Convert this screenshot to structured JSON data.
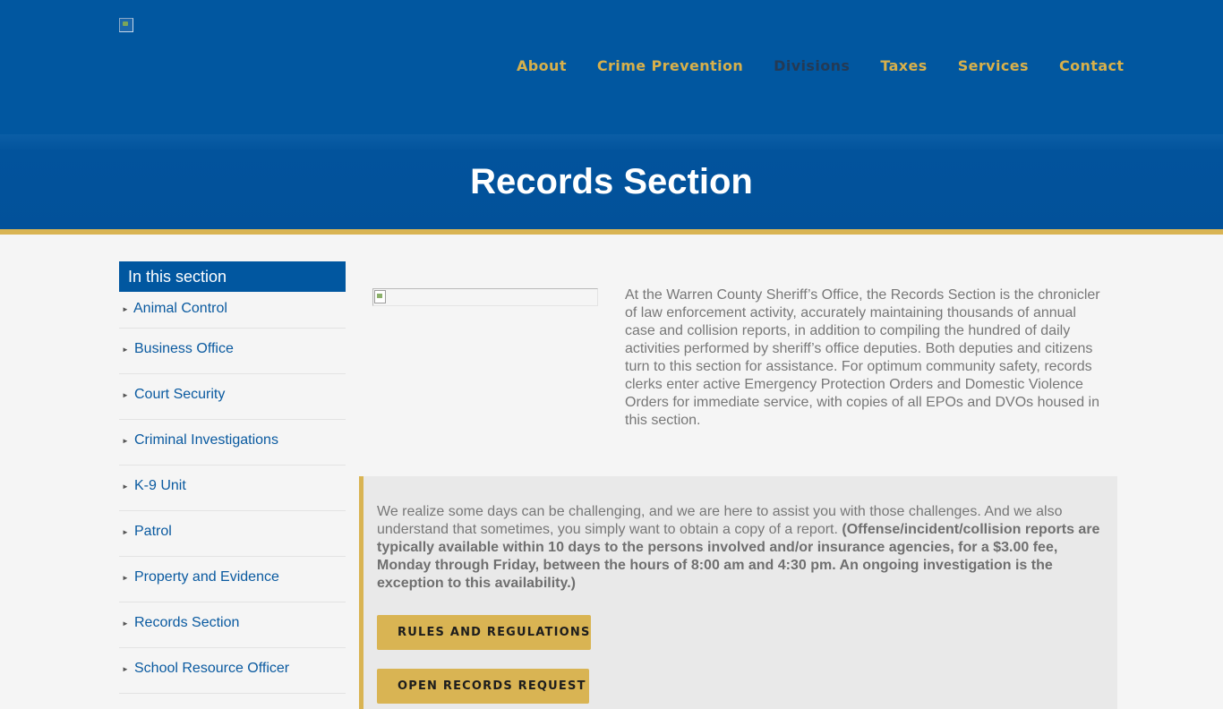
{
  "header": {
    "logo_icon": "broken-image-icon",
    "nav": [
      {
        "label": "About",
        "active": false
      },
      {
        "label": "Crime Prevention",
        "active": false
      },
      {
        "label": "Divisions",
        "active": true
      },
      {
        "label": "Taxes",
        "active": false
      },
      {
        "label": "Services",
        "active": false
      },
      {
        "label": "Contact",
        "active": false
      }
    ]
  },
  "hero": {
    "title": "Records Section"
  },
  "sidebar": {
    "heading": "In this section",
    "items": [
      {
        "label": "Animal Control"
      },
      {
        "label": "Business Office"
      },
      {
        "label": "Court Security"
      },
      {
        "label": "Criminal Investigations"
      },
      {
        "label": "K-9 Unit"
      },
      {
        "label": "Patrol"
      },
      {
        "label": "Property and Evidence"
      },
      {
        "label": "Records Section"
      },
      {
        "label": "School Resource Officer"
      }
    ],
    "arrow_glyph": "►"
  },
  "main": {
    "image_icon": "broken-image-icon",
    "intro": "At the Warren County Sheriff’s Office, the Records Section is the chronicler of law enforcement activity, accurately maintaining thousands of annual case and collision reports, in addition to compiling the hundred of daily activities performed by sheriff’s office deputies. Both deputies and citizens turn to this section for assistance. For optimum community safety, records clerks enter active Emergency Protection Orders and Domestic Violence Orders for immediate service, with copies of all EPOs and DVOs housed in this section.",
    "notice": {
      "text": "We realize some days can be challenging, and we are here to assist you with those challenges. And we also understand that sometimes, you simply want to obtain a copy of a report.",
      "bold": "(Offense/incident/collision reports are typically available within 10 days to the persons involved and/or insurance agencies, for a $3.00 fee, Monday through Friday, between the hours of 8:00 am and 4:30 pm. An ongoing investigation is the exception to this availability.)",
      "buttons": {
        "rules": "RULES AND REGULATIONS",
        "open_records": "OPEN RECORDS REQUEST"
      }
    }
  },
  "colors": {
    "primary_blue": "#0157a0",
    "gold": "#d9b453",
    "nav_gold": "#d7b04b",
    "nav_active": "#243a55",
    "link_blue": "#0a5aa0",
    "body_text": "#777777"
  }
}
